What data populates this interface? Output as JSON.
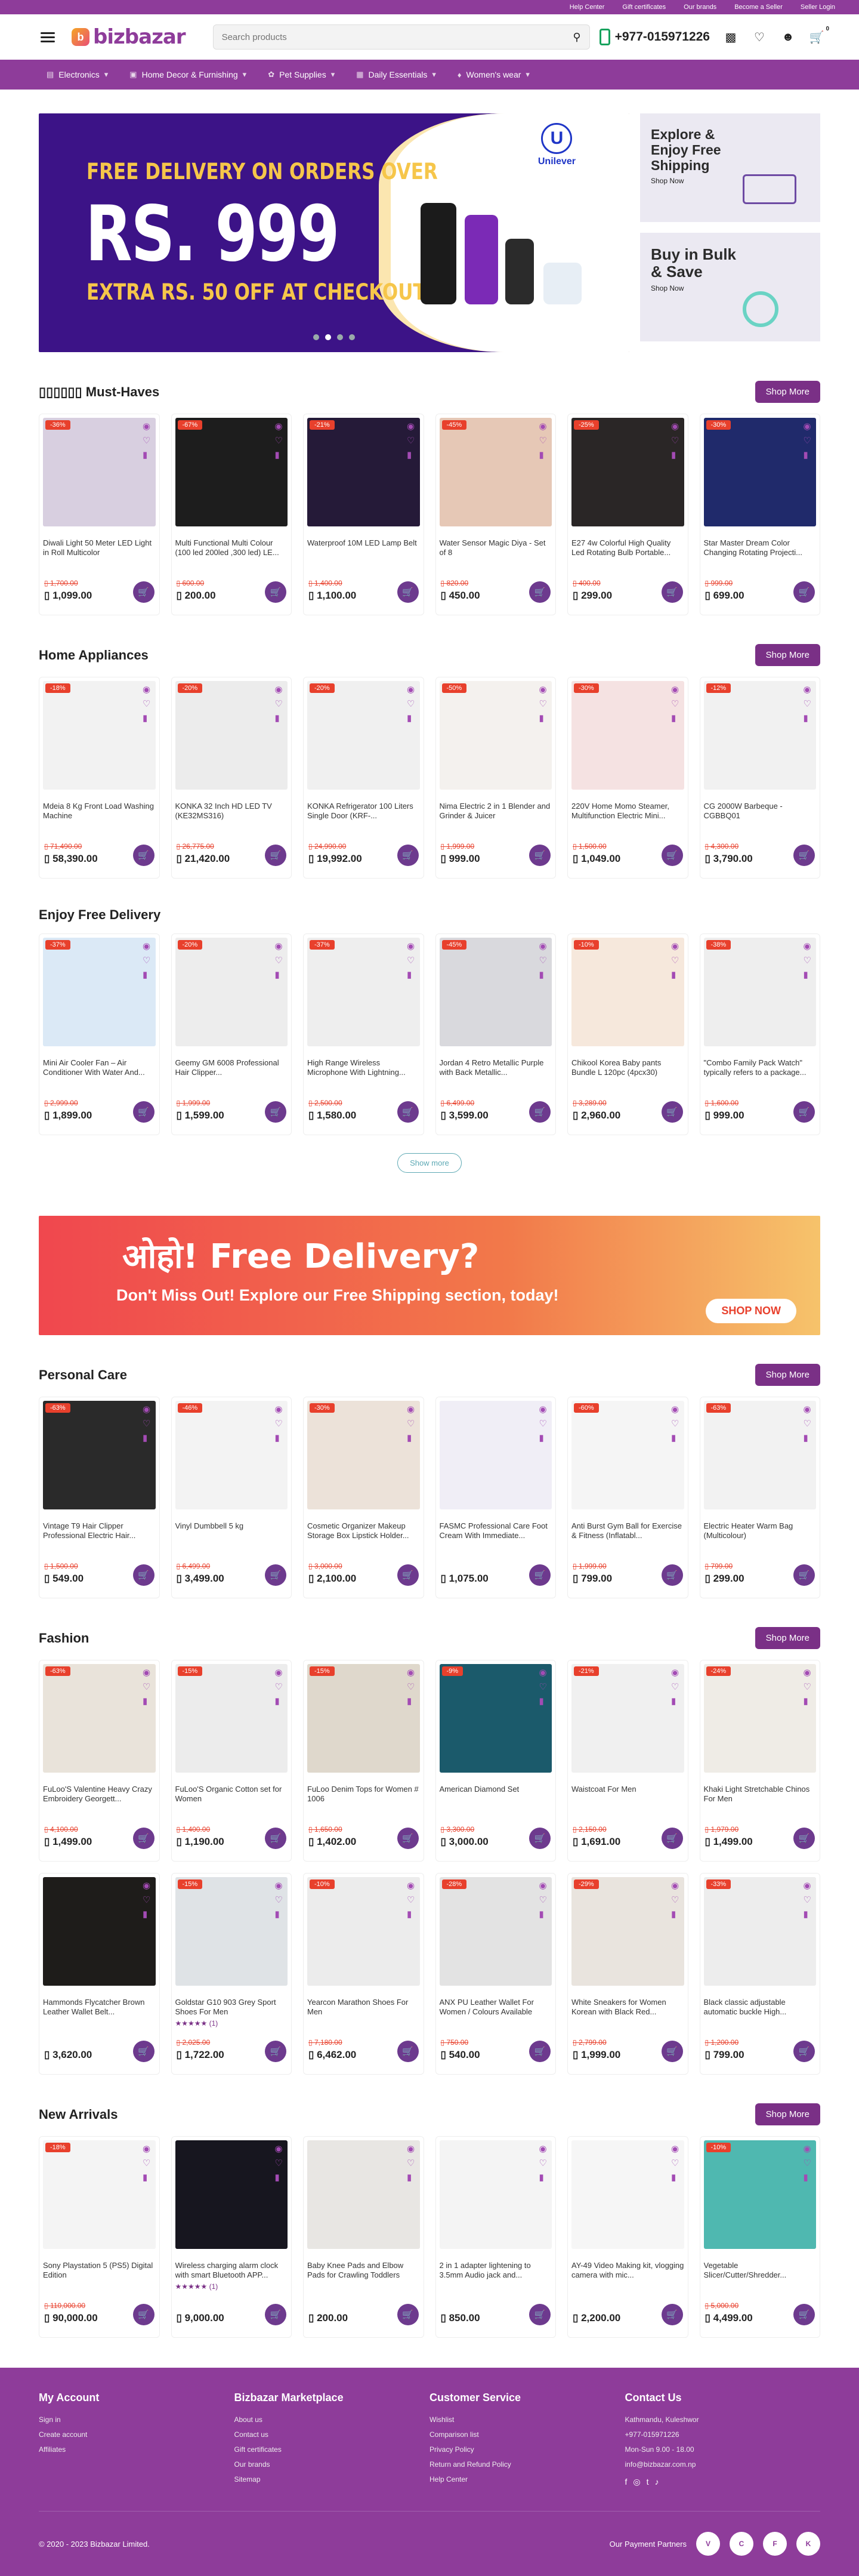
{
  "topbar": [
    "Help Center",
    "Gift certificates",
    "Our brands",
    "Become a Seller",
    "Seller Login"
  ],
  "header": {
    "logo": "bizbazar",
    "search_placeholder": "Search products",
    "phone": "+977-015971226",
    "cart_count": "0"
  },
  "categories": [
    "Electronics",
    "Home Decor & Furnishing",
    "Pet Supplies",
    "Daily Essentials",
    "Women's wear"
  ],
  "hero": {
    "line1": "FREE DELIVERY ON ORDERS OVER",
    "line2": "RS. 999",
    "line3": "EXTRA RS. 50 OFF AT CHECKOUT!",
    "brand": "Unilever"
  },
  "side": [
    {
      "title": "Explore & Enjoy Free Shipping",
      "cta": "Shop Now"
    },
    {
      "title": "Buy in Bulk & Save",
      "cta": "Shop Now"
    }
  ],
  "shop_more": "Shop More",
  "sections": [
    {
      "title": "▯▯▯▯▯▯ Must-Haves",
      "more": true,
      "items": [
        {
          "d": "-36%",
          "t": "Diwali Light 50 Meter LED Light in Roll Multicolor",
          "o": "1,700.00",
          "p": "1,099.00",
          "c": "#d8cfe0"
        },
        {
          "d": "-67%",
          "t": "Multi Functional Multi Colour (100 led 200led ,300 led) LE...",
          "o": "600.00",
          "p": "200.00",
          "c": "#1d1d1d"
        },
        {
          "d": "-21%",
          "t": "Waterproof 10M LED Lamp Belt",
          "o": "1,400.00",
          "p": "1,100.00",
          "c": "#251a38"
        },
        {
          "d": "-45%",
          "t": "Water Sensor Magic Diya - Set of 8",
          "o": "820.00",
          "p": "450.00",
          "c": "#e6c8b6"
        },
        {
          "d": "-25%",
          "t": "E27 4w Colorful High Quality Led Rotating Bulb Portable...",
          "o": "400.00",
          "p": "299.00",
          "c": "#2a2626"
        },
        {
          "d": "-30%",
          "t": "Star Master Dream Color Changing Rotating Projecti...",
          "o": "999.00",
          "p": "699.00",
          "c": "#202a6b"
        }
      ]
    },
    {
      "title": "Home Appliances",
      "more": true,
      "items": [
        {
          "d": "-18%",
          "t": "Mdeia 8 Kg Front Load Washing Machine",
          "o": "71,490.00",
          "p": "58,390.00",
          "c": "#f2f2f2"
        },
        {
          "d": "-20%",
          "t": "KONKA 32 Inch HD LED TV (KE32MS316)",
          "o": "26,775.00",
          "p": "21,420.00",
          "c": "#ececec"
        },
        {
          "d": "-20%",
          "t": "KONKA Refrigerator 100 Liters Single Door (KRF-...",
          "o": "24,990.00",
          "p": "19,992.00",
          "c": "#f0f0f0"
        },
        {
          "d": "-50%",
          "t": "Nima Electric 2 in 1 Blender and Grinder & Juicer",
          "o": "1,999.00",
          "p": "999.00",
          "c": "#f4f1ee"
        },
        {
          "d": "-30%",
          "t": "220V Home Momo Steamer, Multifunction Electric Mini...",
          "o": "1,500.00",
          "p": "1,049.00",
          "c": "#f5e2e2"
        },
        {
          "d": "-12%",
          "t": "CG 2000W Barbeque - CGBBQ01",
          "o": "4,300.00",
          "p": "3,790.00",
          "c": "#f1f1f1"
        }
      ]
    },
    {
      "title": "Enjoy Free Delivery",
      "more": false,
      "items": [
        {
          "d": "-37%",
          "t": "Mini Air Cooler Fan – Air Conditioner With Water And...",
          "o": "2,999.00",
          "p": "1,899.00",
          "c": "#dbe9f6"
        },
        {
          "d": "-20%",
          "t": "Geemy GM 6008 Professional Hair Clipper...",
          "o": "1,999.00",
          "p": "1,599.00",
          "c": "#ededed"
        },
        {
          "d": "-37%",
          "t": "High Range Wireless Microphone With Lightning...",
          "o": "2,500.00",
          "p": "1,580.00",
          "c": "#eeeeee"
        },
        {
          "d": "-45%",
          "t": "Jordan 4 Retro Metallic Purple with Back Metallic...",
          "o": "6,499.00",
          "p": "3,599.00",
          "c": "#d9d9dd"
        },
        {
          "d": "-10%",
          "t": "Chikool Korea Baby pants Bundle L 120pc (4pcx30)",
          "o": "3,289.00",
          "p": "2,960.00",
          "c": "#f6e8dc"
        },
        {
          "d": "-38%",
          "t": "\"Combo Family Pack Watch\" typically refers to a package...",
          "o": "1,600.00",
          "p": "999.00",
          "c": "#eeeeee"
        }
      ]
    },
    {
      "title": "Personal Care",
      "more": true,
      "items": [
        {
          "d": "-63%",
          "t": "Vintage T9 Hair Clipper Professional Electric Hair...",
          "o": "1,500.00",
          "p": "549.00",
          "c": "#2a2a2a"
        },
        {
          "d": "-46%",
          "t": "Vinyl Dumbbell 5 kg",
          "o": "6,499.00",
          "p": "3,499.00",
          "c": "#f3f3f3"
        },
        {
          "d": "-30%",
          "t": "Cosmetic Organizer Makeup Storage Box Lipstick Holder...",
          "o": "3,000.00",
          "p": "2,100.00",
          "c": "#ece2d9"
        },
        {
          "d": "",
          "t": "FASMC Professional Care Foot Cream With Immediate...",
          "o": "",
          "p": "1,075.00",
          "c": "#f0eef6"
        },
        {
          "d": "-60%",
          "t": "Anti Burst Gym Ball for Exercise & Fitness (Inflatabl...",
          "o": "1,999.00",
          "p": "799.00",
          "c": "#f5f5f5"
        },
        {
          "d": "-63%",
          "t": "Electric Heater Warm Bag (Multicolour)",
          "o": "799.00",
          "p": "299.00",
          "c": "#f2f2f2"
        }
      ]
    },
    {
      "title": "Fashion",
      "more": true,
      "items": [
        {
          "d": "-63%",
          "t": "FuLoo'S Valentine Heavy Crazy Embroidery Georgett...",
          "o": "4,100.00",
          "p": "1,499.00",
          "c": "#e9e3da"
        },
        {
          "d": "-15%",
          "t": "FuLoo'S Organic Cotton set for Women",
          "o": "1,400.00",
          "p": "1,190.00",
          "c": "#ececec"
        },
        {
          "d": "-15%",
          "t": "FuLoo Denim Tops for Women # 1006",
          "o": "1,650.00",
          "p": "1,402.00",
          "c": "#dfd8cc"
        },
        {
          "d": "-9%",
          "t": "American Diamond Set",
          "o": "3,300.00",
          "p": "3,000.00",
          "c": "#1b5a6b"
        },
        {
          "d": "-21%",
          "t": "Waistcoat For Men",
          "o": "2,150.00",
          "p": "1,691.00",
          "c": "#f0f0f0"
        },
        {
          "d": "-24%",
          "t": "Khaki Light Stretchable Chinos For Men",
          "o": "1,979.00",
          "p": "1,499.00",
          "c": "#efece6"
        },
        {
          "d": "",
          "t": "Hammonds Flycatcher Brown Leather Wallet Belt...",
          "o": "",
          "p": "3,620.00",
          "c": "#1e1c1a"
        },
        {
          "d": "-15%",
          "t": "Goldstar G10 903 Grey Sport Shoes For Men",
          "o": "2,025.00",
          "p": "1,722.00",
          "c": "#dfe3e6",
          "s": "★★★★★ (1)"
        },
        {
          "d": "-10%",
          "t": "Yearcon Marathon Shoes For Men",
          "o": "7,180.00",
          "p": "6,462.00",
          "c": "#ececec"
        },
        {
          "d": "-28%",
          "t": "ANX PU Leather Wallet For Women / Colours Available",
          "o": "750.00",
          "p": "540.00",
          "c": "#e3e3e3"
        },
        {
          "d": "-29%",
          "t": "White Sneakers for Women Korean with Black Red...",
          "o": "2,799.00",
          "p": "1,999.00",
          "c": "#e9e4de"
        },
        {
          "d": "-33%",
          "t": "Black classic adjustable automatic buckle High...",
          "o": "1,200.00",
          "p": "799.00",
          "c": "#ededed"
        }
      ]
    },
    {
      "title": "New Arrivals",
      "more": true,
      "items": [
        {
          "d": "-18%",
          "t": "Sony Playstation 5 (PS5) Digital Edition",
          "o": "110,000.00",
          "p": "90,000.00",
          "c": "#f4f4f4"
        },
        {
          "d": "",
          "t": "Wireless charging alarm clock with smart Bluetooth APP...",
          "o": "",
          "p": "9,000.00",
          "c": "#17161f",
          "s": "★★★★★ (1)"
        },
        {
          "d": "",
          "t": "Baby Knee Pads and Elbow Pads for Crawling Toddlers",
          "o": "",
          "p": "200.00",
          "c": "#e8e6e3"
        },
        {
          "d": "",
          "t": "2 in 1 adapter lightening to 3.5mm Audio jack and...",
          "o": "",
          "p": "850.00",
          "c": "#f4f4f4"
        },
        {
          "d": "",
          "t": "AY-49 Video Making kit, vlogging camera with mic...",
          "o": "",
          "p": "2,200.00",
          "c": "#f6f6f6"
        },
        {
          "d": "-10%",
          "t": "Vegetable Slicer/Cutter/Shredder...",
          "o": "5,000.00",
          "p": "4,499.00",
          "c": "#4fb8b0"
        }
      ]
    }
  ],
  "delivery": {
    "title": "ओहो! Free Delivery?",
    "sub": "Don't Miss Out! Explore our Free Shipping section, today!",
    "cta": "SHOP NOW"
  },
  "show_more": "Show more",
  "footer": {
    "cols": [
      {
        "h": "My Account",
        "links": [
          "Sign in",
          "Create account",
          "Affiliates"
        ]
      },
      {
        "h": "Bizbazar Marketplace",
        "links": [
          "About us",
          "Contact us",
          "Gift certificates",
          "Our brands",
          "Sitemap"
        ]
      },
      {
        "h": "Customer Service",
        "links": [
          "Wishlist",
          "Comparison list",
          "Privacy Policy",
          "Return and Refund Policy",
          "Help Center"
        ]
      },
      {
        "h": "Contact Us",
        "links": [
          "Kathmandu, Kuleshwor",
          "+977-015971226",
          "Mon-Sun 9.00 - 18.00",
          "info@bizbazar.com.np"
        ]
      }
    ],
    "copyright": "© 2020 - 2023 Bizbazar Limited.",
    "partners": "Our Payment Partners"
  }
}
